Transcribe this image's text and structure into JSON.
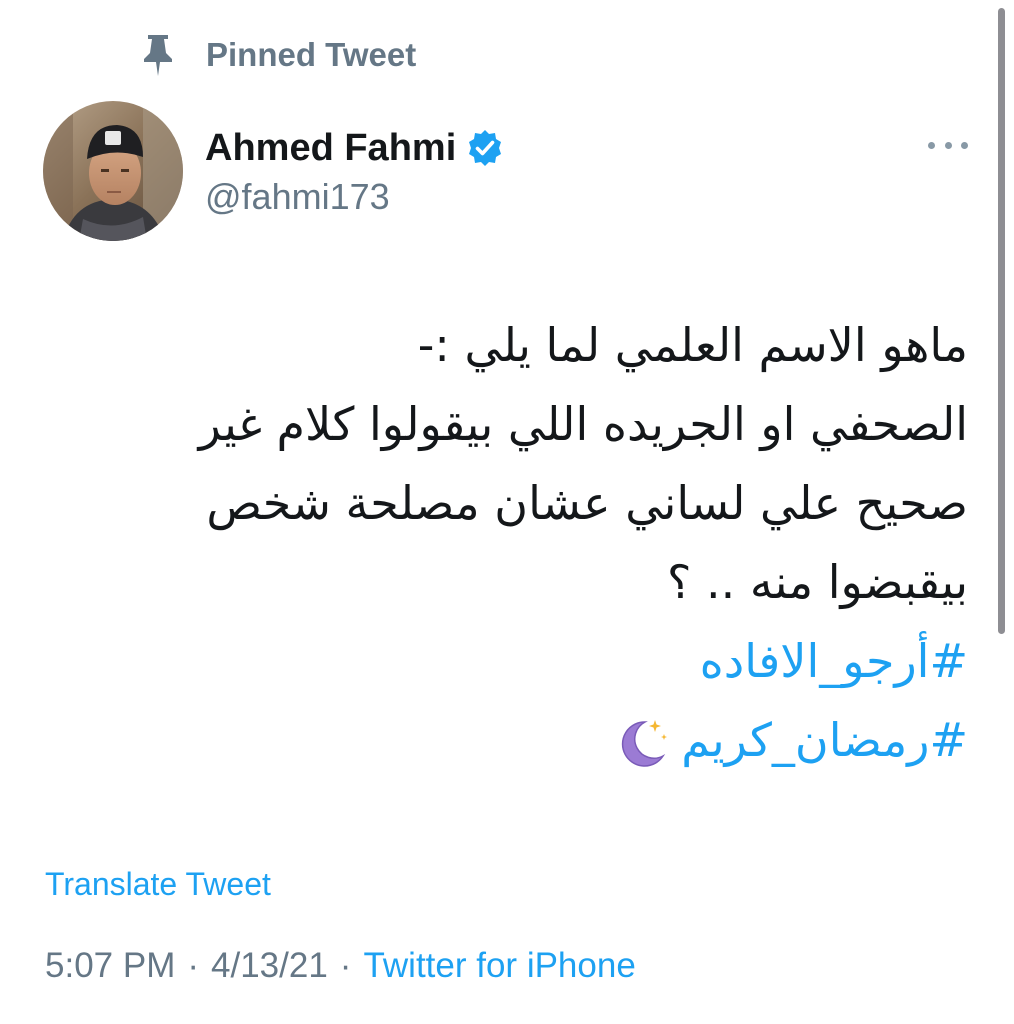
{
  "pinned": {
    "label": "Pinned Tweet",
    "icon": "pin-icon"
  },
  "author": {
    "display_name": "Ahmed Fahmi",
    "handle": "@fahmi173",
    "verified": true,
    "verified_icon": "verified-badge-icon",
    "avatar_icon": "avatar"
  },
  "more_menu": {
    "icon": "more-options-icon"
  },
  "tweet": {
    "lines": [
      "ماهو الاسم العلمي  لما يلي :-",
      "الصحفي او الجريده اللي بيقولوا كلام غير",
      "صحيح علي لساني عشان مصلحة شخص",
      "بيقبضوا منه .. ؟"
    ],
    "hashtags": [
      "#أرجو_الافاده",
      "#رمضان_كريم"
    ],
    "emoji_icon": "crescent-moon-icon"
  },
  "translate": {
    "label": "Translate Tweet"
  },
  "meta": {
    "time": "5:07 PM",
    "separator": "·",
    "date": "4/13/21",
    "source": "Twitter for iPhone"
  },
  "colors": {
    "link": "#1da1f2",
    "secondary_text": "#657786",
    "primary_text": "#14171a",
    "background": "#ffffff"
  }
}
